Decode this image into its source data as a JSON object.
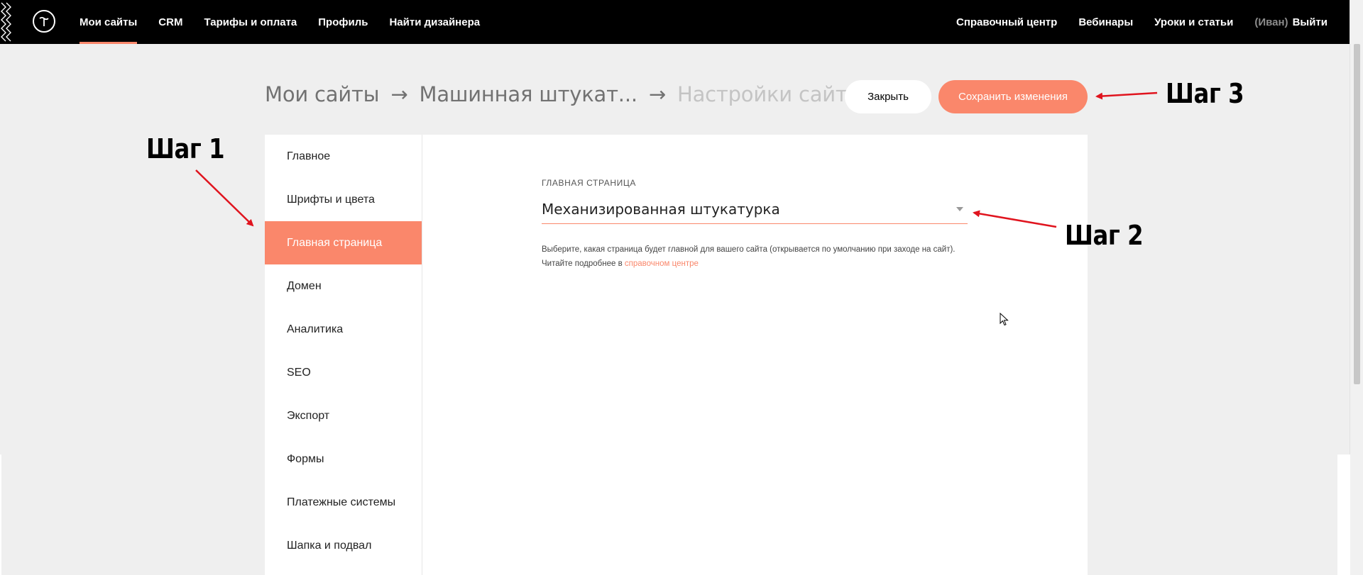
{
  "nav": {
    "left": [
      "Мои сайты",
      "CRM",
      "Тарифы и оплата",
      "Профиль",
      "Найти дизайнера"
    ],
    "right": [
      "Справочный центр",
      "Вебинары",
      "Уроки и статьи"
    ],
    "user": "(Иван)",
    "logout": "Выйти",
    "logo_icon": "tilda-logo-icon"
  },
  "breadcrumb": {
    "sites": "Мои сайты",
    "separator": "→",
    "project": "Машинная штукат...",
    "current": "Настройки сайта"
  },
  "buttons": {
    "close": "Закрыть",
    "save": "Сохранить изменения"
  },
  "sidebar": {
    "items": [
      {
        "label": "Главное"
      },
      {
        "label": "Шрифты и цвета"
      },
      {
        "label": "Главная страница"
      },
      {
        "label": "Домен"
      },
      {
        "label": "Аналитика"
      },
      {
        "label": "SEO"
      },
      {
        "label": "Экспорт"
      },
      {
        "label": "Формы"
      },
      {
        "label": "Платежные системы"
      },
      {
        "label": "Шапка и подвал"
      }
    ],
    "active_index": 2
  },
  "main": {
    "label": "ГЛАВНАЯ СТРАНИЦА",
    "selected_page": "Механизированная штукатурка",
    "help_text": "Выберите, какая страница будет главной для вашего сайта (открывается по умолчанию при заходе на сайт). Читайте подробнее в ",
    "help_link": "справочном центре"
  },
  "annotations": {
    "step1": "Шаг 1",
    "step2": "Шаг 2",
    "step3": "Шаг 3"
  },
  "colors": {
    "accent": "#fa876b",
    "nav_bg": "#000000",
    "page_bg": "#efefef",
    "arrow": "#e0141e"
  }
}
